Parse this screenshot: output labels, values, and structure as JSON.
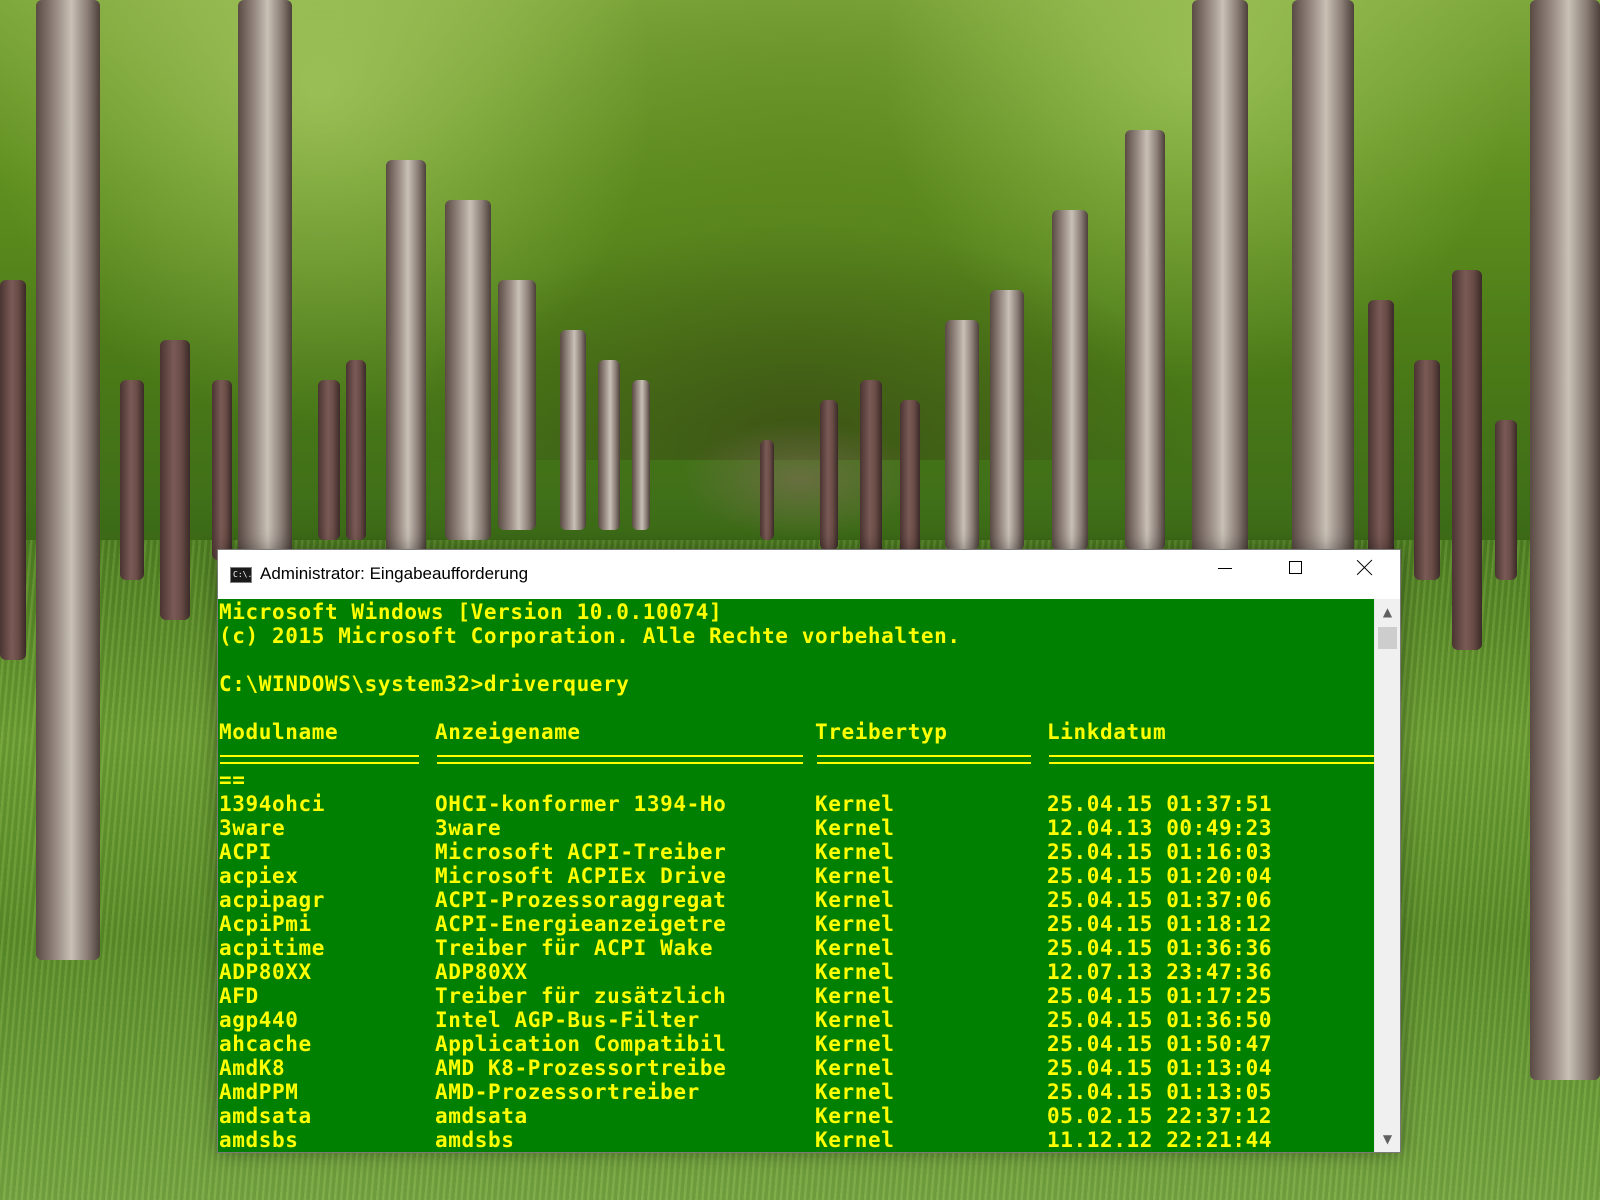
{
  "window": {
    "title": "Administrator: Eingabeaufforderung",
    "icon_label": "C:\\.",
    "buttons": {
      "minimize_icon": "minimize-icon",
      "maximize_icon": "maximize-icon",
      "close_icon": "close-icon"
    }
  },
  "console": {
    "background_color": "#008000",
    "text_color": "#ffff00",
    "banner": [
      "Microsoft Windows [Version 10.0.10074]",
      "(c) 2015 Microsoft Corporation. Alle Rechte vorbehalten."
    ],
    "prompt": "C:\\WINDOWS\\system32>driverquery",
    "table": {
      "headers": [
        "Modulname",
        "Anzeigename",
        "Treibertyp",
        "Linkdatum"
      ],
      "separator_wrap": "==",
      "rows": [
        [
          "1394ohci",
          "OHCI-konformer 1394-Ho",
          "Kernel",
          "25.04.15 01:37:51"
        ],
        [
          "3ware",
          "3ware",
          "Kernel",
          "12.04.13 00:49:23"
        ],
        [
          "ACPI",
          "Microsoft ACPI-Treiber",
          "Kernel",
          "25.04.15 01:16:03"
        ],
        [
          "acpiex",
          "Microsoft ACPIEx Drive",
          "Kernel",
          "25.04.15 01:20:04"
        ],
        [
          "acpipagr",
          "ACPI-Prozessoraggregat",
          "Kernel",
          "25.04.15 01:37:06"
        ],
        [
          "AcpiPmi",
          "ACPI-Energieanzeigetre",
          "Kernel",
          "25.04.15 01:18:12"
        ],
        [
          "acpitime",
          "Treiber für ACPI Wake",
          "Kernel",
          "25.04.15 01:36:36"
        ],
        [
          "ADP80XX",
          "ADP80XX",
          "Kernel",
          "12.07.13 23:47:36"
        ],
        [
          "AFD",
          "Treiber für zusätzlich",
          "Kernel",
          "25.04.15 01:17:25"
        ],
        [
          "agp440",
          "Intel AGP-Bus-Filter",
          "Kernel",
          "25.04.15 01:36:50"
        ],
        [
          "ahcache",
          "Application Compatibil",
          "Kernel",
          "25.04.15 01:50:47"
        ],
        [
          "AmdK8",
          "AMD K8-Prozessortreibe",
          "Kernel",
          "25.04.15 01:13:04"
        ],
        [
          "AmdPPM",
          "AMD-Prozessortreiber",
          "Kernel",
          "25.04.15 01:13:05"
        ],
        [
          "amdsata",
          "amdsata",
          "Kernel",
          "05.02.15 22:37:12"
        ],
        [
          "amdsbs",
          "amdsbs",
          "Kernel",
          "11.12.12 22:21:44"
        ]
      ]
    }
  },
  "scrollbar": {
    "up_icon": "scroll-up-arrow-icon",
    "down_icon": "scroll-down-arrow-icon"
  }
}
